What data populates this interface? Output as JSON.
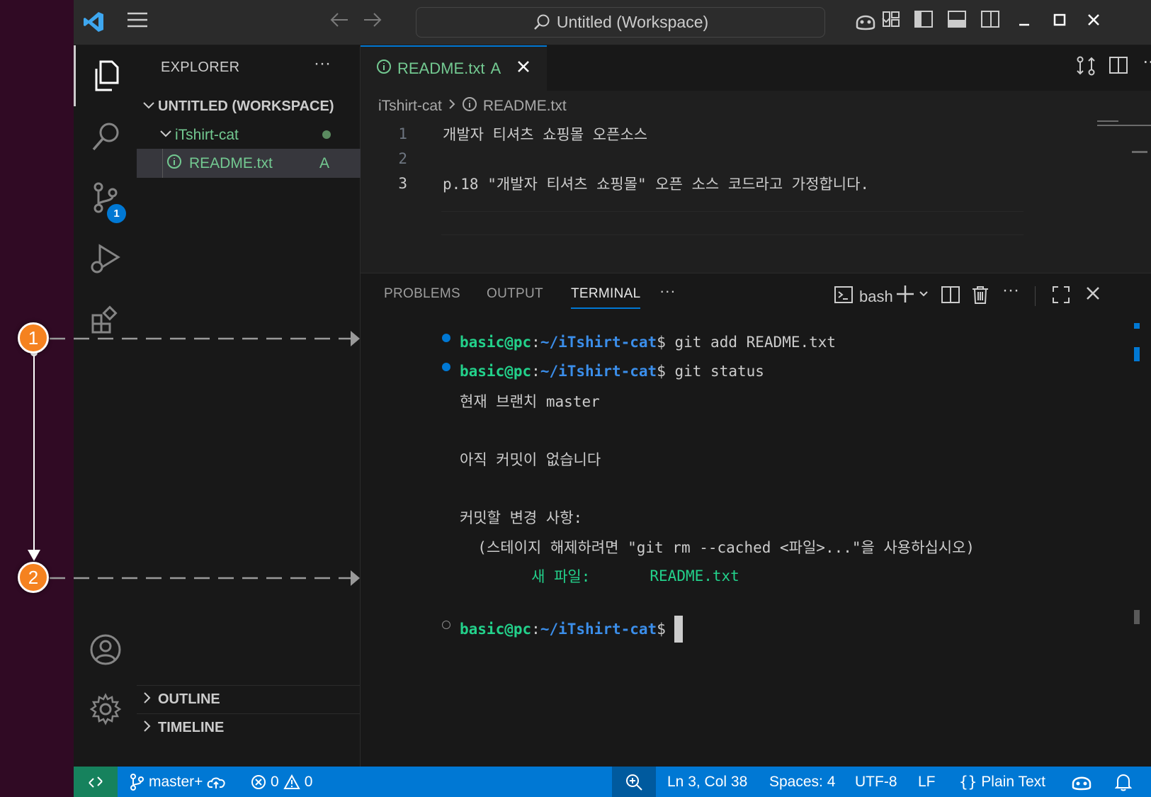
{
  "titlebar": {
    "search_text": "Untitled (Workspace)"
  },
  "activity": {
    "scm_badge": "1"
  },
  "sidebar": {
    "title": "EXPLORER",
    "more": "···",
    "workspace": "UNTITLED (WORKSPACE)",
    "folder": "iTshirt-cat",
    "file": "README.txt",
    "file_status": "A",
    "outline": "OUTLINE",
    "timeline": "TIMELINE"
  },
  "editor": {
    "tab_label": "README.txt",
    "tab_status": "A",
    "breadcrumb_folder": "iTshirt-cat",
    "breadcrumb_file": "README.txt",
    "lines": [
      {
        "num": "1",
        "text": "개발자 티셔츠 쇼핑몰 오픈소스"
      },
      {
        "num": "2",
        "text": ""
      },
      {
        "num": "3",
        "text": "p.18 \"개발자 티셔츠 쇼핑몰\" 오픈 소스 코드라고 가정합니다."
      }
    ]
  },
  "panel": {
    "tabs": [
      "PROBLEMS",
      "OUTPUT",
      "TERMINAL"
    ],
    "more": "···",
    "shell": "bash",
    "terminal": {
      "user_host": "basic@pc",
      "path": "~/iTshirt-cat",
      "prompt_suffix": "$ ",
      "colon": ":",
      "cmd1": "git add README.txt",
      "cmd2": "git status",
      "out1": "현재 브랜치 master",
      "out2": "아직 커밋이 없습니다",
      "out3": "커밋할 변경 사항:",
      "out4": "  (스테이지 해제하려면 \"git rm --cached <파일>...\"을 사용하십시오)",
      "out5_label": "        새 파일:",
      "out5_file": "README.txt"
    }
  },
  "statusbar": {
    "branch": "master+",
    "errors": "0",
    "warnings": "0",
    "position": "Ln 3, Col 38",
    "spaces": "Spaces: 4",
    "encoding": "UTF-8",
    "eol": "LF",
    "language": "Plain Text"
  },
  "annotations": {
    "marker1": "1",
    "marker2": "2"
  },
  "colors": {
    "accent": "#0078d4",
    "git_added": "#73c991",
    "annotation": "#f58220",
    "terminal_green": "#23d18b",
    "terminal_blue": "#3b8eea"
  }
}
